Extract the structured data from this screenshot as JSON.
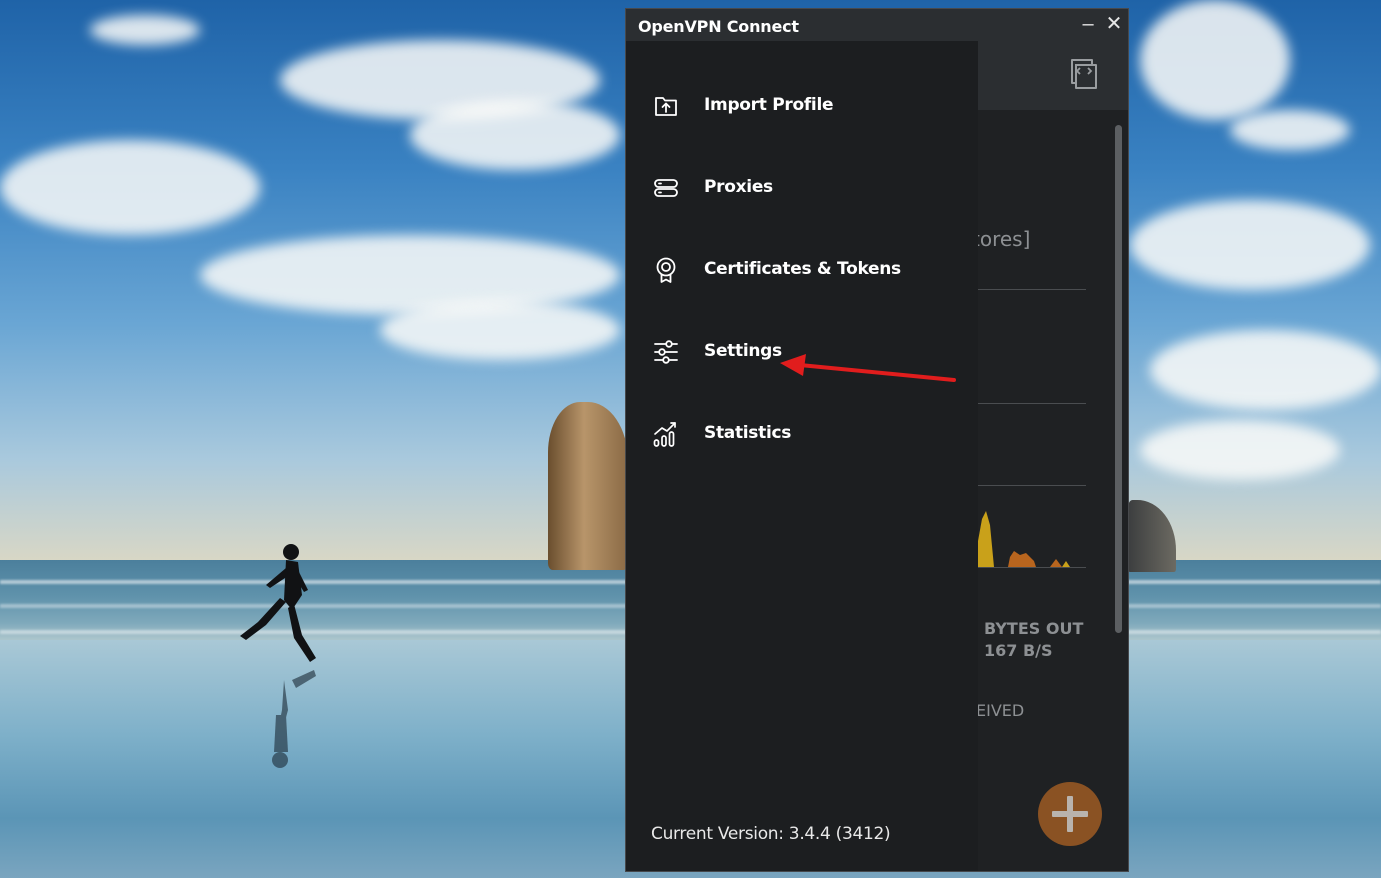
{
  "window": {
    "title": "OpenVPN Connect",
    "minimize_label": "–",
    "close_label": "✕"
  },
  "menu": {
    "items": [
      {
        "label": "Import Profile",
        "icon": "import-profile-icon"
      },
      {
        "label": "Proxies",
        "icon": "proxies-icon"
      },
      {
        "label": "Certificates & Tokens",
        "icon": "certificate-icon"
      },
      {
        "label": "Settings",
        "icon": "settings-sliders-icon"
      },
      {
        "label": "Statistics",
        "icon": "statistics-icon"
      }
    ],
    "version": "Current Version: 3.4.4 (3412)"
  },
  "background_content": {
    "profile_fragment": "tores]",
    "bytes_out_label": "BYTES OUT",
    "bytes_out_value": "167 B/S",
    "received_fragment": "EIVED"
  },
  "colors": {
    "drawer_bg": "#1c1e20",
    "window_bg": "#2b2e31",
    "fab": "#8a5223",
    "annotation_arrow": "#e11d1d",
    "graph_yellow": "#c9a11a",
    "graph_orange": "#b8651e"
  }
}
